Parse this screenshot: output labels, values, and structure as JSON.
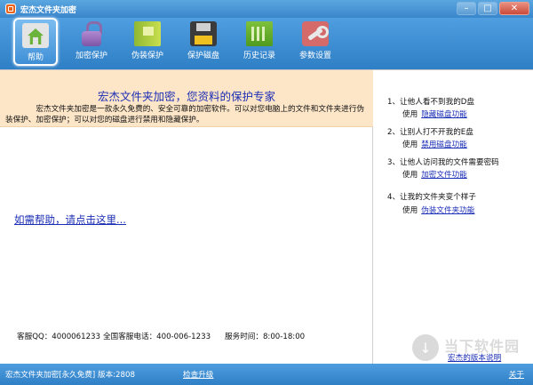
{
  "window": {
    "title": "宏杰文件夹加密",
    "minimize": "–",
    "maximize": "□",
    "close": "✕"
  },
  "toolbar": {
    "items": [
      {
        "label": "帮助",
        "icon": "help-home-icon",
        "active": true
      },
      {
        "label": "加密保护",
        "icon": "lock-icon"
      },
      {
        "label": "伪装保护",
        "icon": "disguise-book-icon"
      },
      {
        "label": "保护磁盘",
        "icon": "disk-icon"
      },
      {
        "label": "历史记录",
        "icon": "history-icon"
      },
      {
        "label": "参数设置",
        "icon": "settings-wrench-icon"
      }
    ]
  },
  "intro": {
    "title": "宏杰文件夹加密，您资料的保护专家",
    "text": "宏杰文件夹加密是一款永久免费的、安全可靠的加密软件。可以对您电脑上的文件和文件夹进行伪装保护、加密保护；可以对您的磁盘进行禁用和隐藏保护。"
  },
  "help_link": "如需帮助，请点击这里...",
  "contact": {
    "qq": "客服QQ：4000061233",
    "phone": "全国客服电话：400-006-1233",
    "hours": "服务时间：8:00-18:00"
  },
  "tips": [
    {
      "question": "1、让他人看不到我的D盘",
      "use": "使用",
      "link": "隐藏磁盘功能"
    },
    {
      "question": "2、让别人打不开我的E盘",
      "use": "使用",
      "link": "禁用磁盘功能"
    },
    {
      "question": "3、让他人访问我的文件需要密码",
      "use": "使用",
      "link": "加密文件功能"
    },
    {
      "question": "4、让我的文件夹变个样子",
      "use": "使用",
      "link": "伪装文件夹功能"
    }
  ],
  "watermark": {
    "text": "当下软件园",
    "version_link": "宏杰的版本说明"
  },
  "statusbar": {
    "left": "宏杰文件夹加密[永久免费] 版本:2808",
    "upgrade": "检查升级",
    "close": "关于"
  }
}
